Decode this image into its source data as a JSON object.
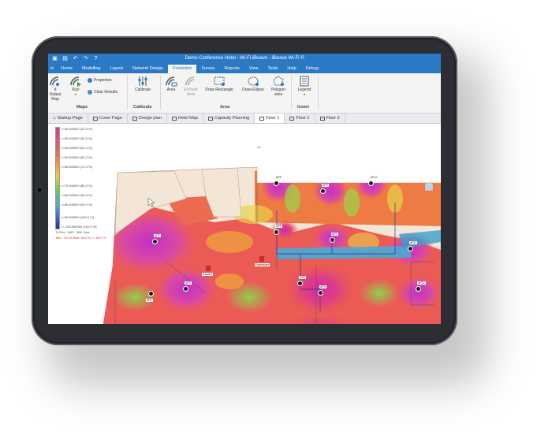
{
  "window": {
    "title": "Demo Conference Hotel - Wi-Fi.iBwave - iBwave Wi-Fi ®"
  },
  "menu_tabs": [
    "le",
    "Home",
    "Modelling",
    "Layout",
    "Network Design",
    "Prediction",
    "Survey",
    "Reports",
    "View",
    "Tools",
    "Help",
    "Debug"
  ],
  "active_menu_tab": "Prediction",
  "ribbon": {
    "maps": {
      "group_label": "Maps",
      "output_map_label": "d Output Map",
      "run_label": "Run",
      "properties_label": "Properties",
      "clear_results_label": "Clear Results"
    },
    "calibrate": {
      "group_label": "Calibrate",
      "calibrate_label": "Calibrate"
    },
    "area": {
      "group_label": "Area",
      "area_label": "Area",
      "exclude_area_label": "Exclude Area",
      "draw_rectangle_label": "Draw Rectangle",
      "draw_ellipse_label": "Draw Ellipse",
      "polygon_area_label": "Polygon area"
    },
    "insert": {
      "group_label": "Insert",
      "legend_label": "Legend"
    }
  },
  "doc_tabs": [
    "Startup Page",
    "Cover Page",
    "Design plan",
    "Hotel Map",
    "Capacity Planning",
    "Floor 1",
    "Floor 2",
    "Floor 3"
  ],
  "active_doc_tab": "Floor 1",
  "legend": {
    "entries": [
      ">=40.000000 (32.5 %)",
      ">=40.000000 (32.5 %)",
      ">=45.000000 (60.4 %)",
      ">=50.000000 (63.2 %)",
      ">=55.000000 (71.3 %)",
      ">=75.000000 (85.3 %)",
      ">=80.000000 (90.5 %)",
      ">=85.000000 (95.3 %)",
      ">=90.000000 (100.0 %)",
      ">=-100.000000 (100.0 %)"
    ],
    "footer": "5 GHz - WiFi - 802.11ac",
    "footer_red": "Min: -75.00 dBm: 98.3 % >= 80.0 %"
  },
  "ap_labels": [
    "AP1",
    "AP2",
    "AP3",
    "AP4",
    "AP5",
    "AP6",
    "AP7",
    "AP8",
    "AP9",
    "AP10",
    "AP11",
    "AP12"
  ],
  "room_labels": [
    "Gazebo",
    "Entertainer"
  ],
  "colors": {
    "titlebar": "#2b79c4",
    "heat_high": "#d93a9a",
    "heat_mid": "#ef6a3a",
    "heat_low": "#8fd04a"
  }
}
